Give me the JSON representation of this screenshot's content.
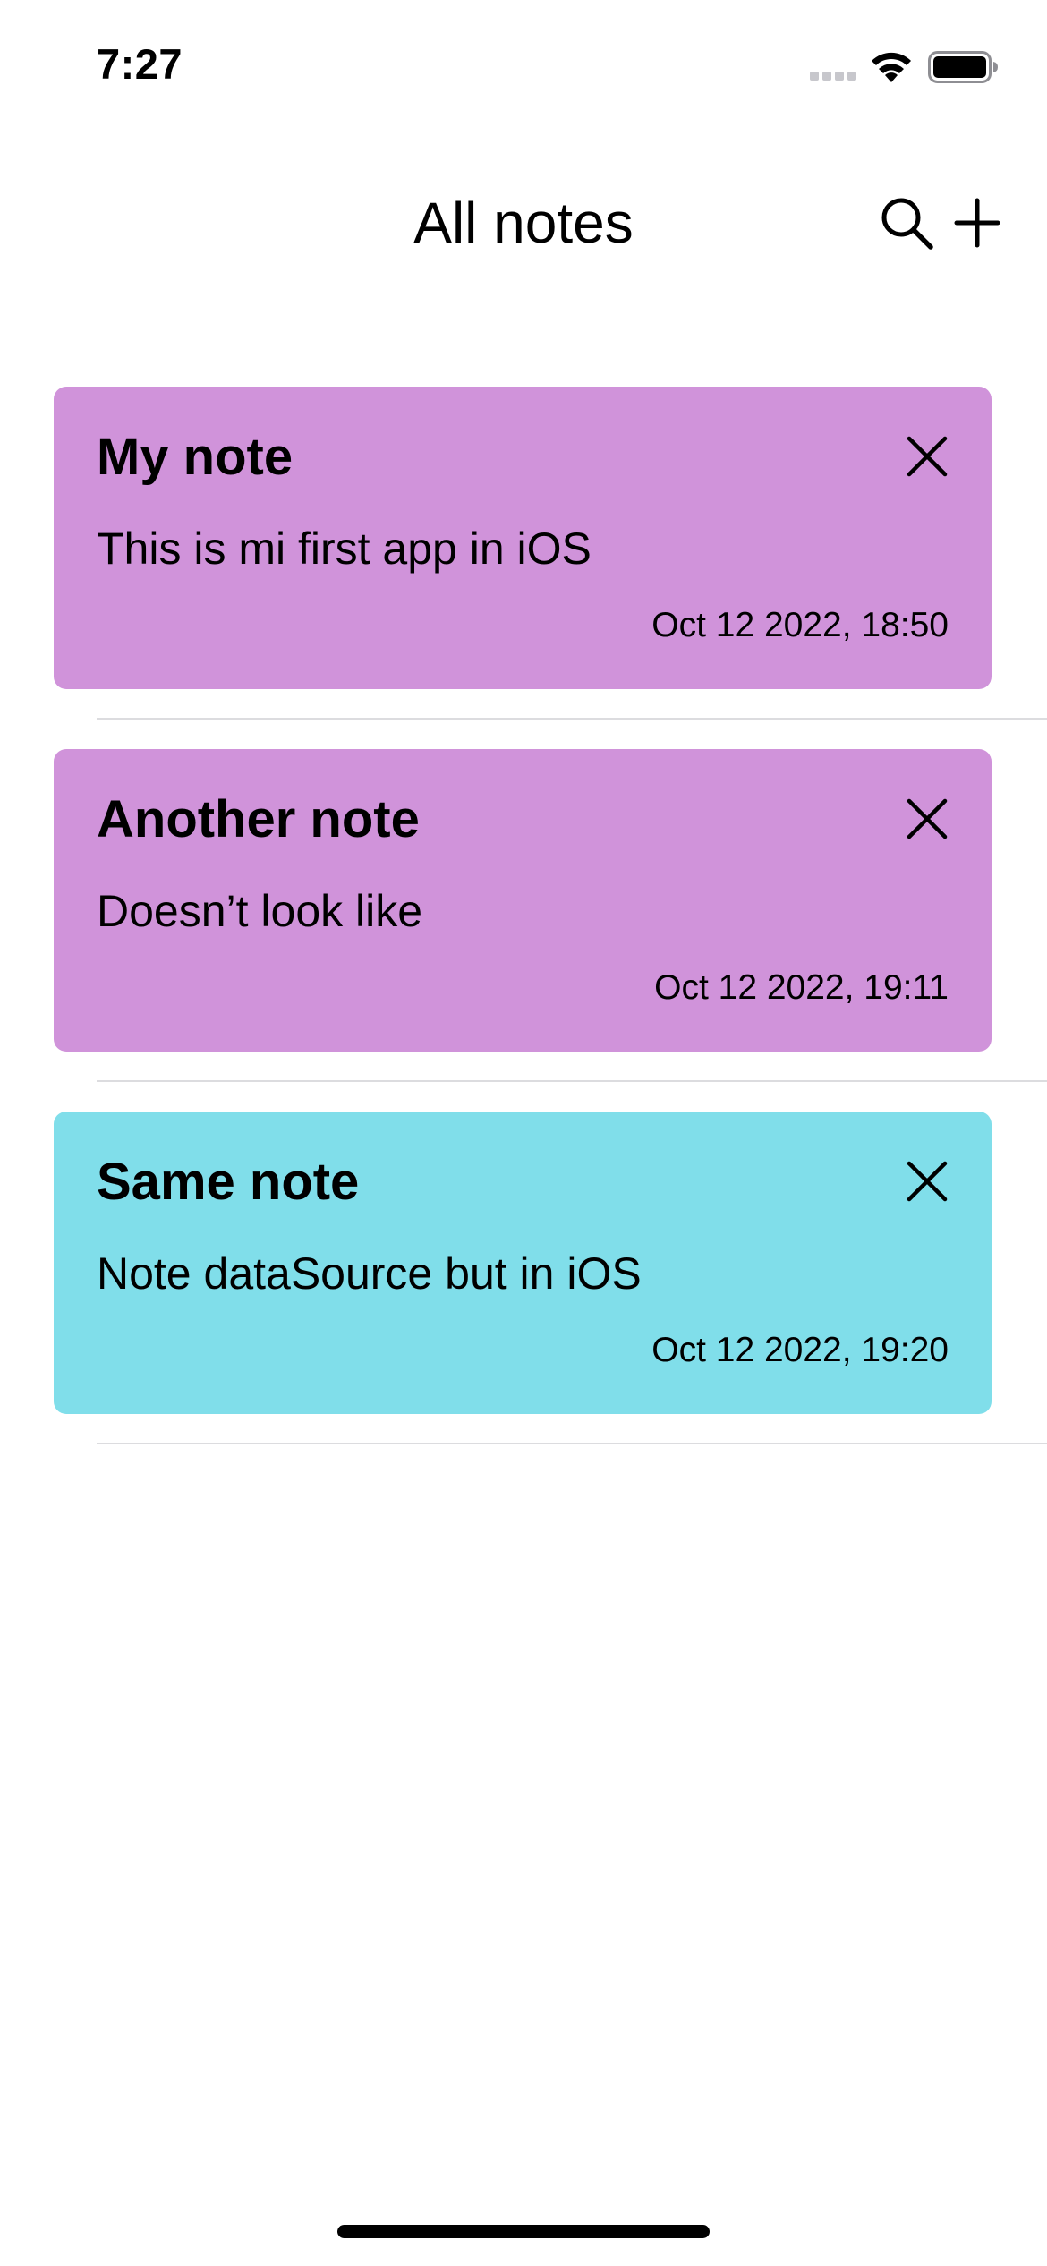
{
  "status_bar": {
    "time": "7:27",
    "signal_icon": "cellular-signal-icon",
    "wifi_icon": "wifi-icon",
    "battery_icon": "battery-icon"
  },
  "nav": {
    "title": "All notes",
    "search_icon": "search-icon",
    "add_icon": "plus-icon"
  },
  "notes": [
    {
      "title": "My note",
      "body": "This is mi first app in iOS",
      "date": "Oct 12 2022, 18:50",
      "color": "#d093da",
      "delete_icon": "close-icon"
    },
    {
      "title": "Another note",
      "body": "Doesn’t look like",
      "date": "Oct 12 2022, 19:11",
      "color": "#d093da",
      "delete_icon": "close-icon"
    },
    {
      "title": "Same note",
      "body": "Note dataSource but in iOS",
      "date": "Oct 12 2022, 19:20",
      "color": "#80deea",
      "delete_icon": "close-icon"
    }
  ]
}
